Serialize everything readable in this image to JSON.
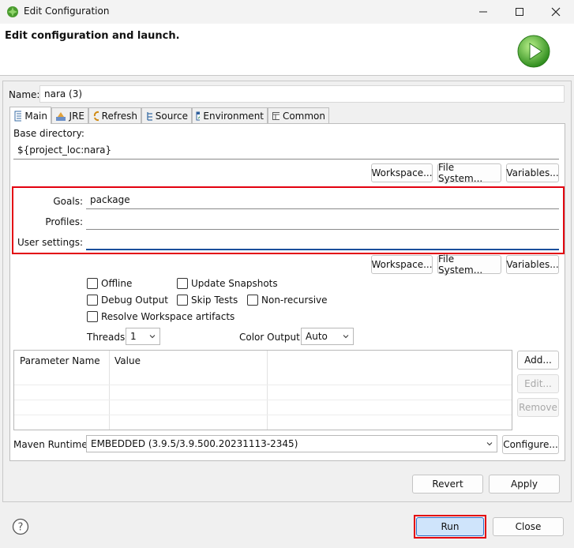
{
  "window": {
    "title": "Edit Configuration"
  },
  "banner": {
    "title": "Edit configuration and launch."
  },
  "name_field": {
    "label": "Name:",
    "value": "nara (3)"
  },
  "tabs": [
    {
      "label": "Main",
      "icon": "document-icon"
    },
    {
      "label": "JRE",
      "icon": "jre-icon"
    },
    {
      "label": "Refresh",
      "icon": "refresh-icon"
    },
    {
      "label": "Source",
      "icon": "source-icon"
    },
    {
      "label": "Environment",
      "icon": "environment-icon"
    },
    {
      "label": "Common",
      "icon": "common-icon"
    }
  ],
  "main": {
    "base_dir_label": "Base directory:",
    "base_dir_value": "${project_loc:nara}",
    "workspace_btn": "Workspace...",
    "filesystem_btn": "File System...",
    "variables_btn": "Variables...",
    "goals_label": "Goals:",
    "goals_value": "package",
    "profiles_label": "Profiles:",
    "profiles_value": "",
    "user_settings_label": "User settings:",
    "user_settings_value": "",
    "options": {
      "offline": "Offline",
      "update_snapshots": "Update Snapshots",
      "debug_output": "Debug Output",
      "skip_tests": "Skip Tests",
      "non_recursive": "Non-recursive",
      "resolve_workspace": "Resolve Workspace artifacts"
    },
    "threads_label": "Threads:",
    "threads_value": "1",
    "color_output_label": "Color Output:",
    "color_output_value": "Auto",
    "table": {
      "columns": [
        "Parameter Name",
        "Value"
      ],
      "rows": []
    },
    "add_btn": "Add...",
    "edit_btn": "Edit...",
    "remove_btn": "Remove",
    "maven_runtime_label": "Maven Runtime:",
    "maven_runtime_value": "EMBEDDED (3.9.5/3.9.500.20231113-2345)",
    "configure_btn": "Configure..."
  },
  "footer": {
    "revert_btn": "Revert",
    "apply_btn": "Apply",
    "run_btn": "Run",
    "close_btn": "Close"
  },
  "colors": {
    "highlight": "#e3000f",
    "focus": "#1a4f9c",
    "run_bg": "#cfe4fb"
  }
}
